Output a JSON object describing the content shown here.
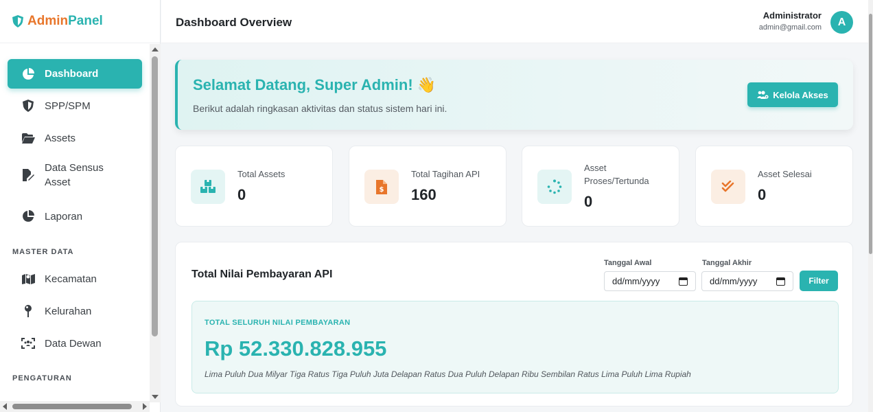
{
  "brand": {
    "part1": "Admin",
    "part2": "Panel"
  },
  "sidebar": {
    "items": [
      {
        "label": "Dashboard",
        "icon": "chart-pie-icon"
      },
      {
        "label": "SPP/SPM",
        "icon": "shield-icon"
      },
      {
        "label": "Assets",
        "icon": "folder-open-icon"
      },
      {
        "label": "Data Sensus Asset",
        "icon": "file-signature-icon"
      },
      {
        "label": "Laporan",
        "icon": "chart-pie-icon"
      }
    ],
    "section_master": "MASTER DATA",
    "master_items": [
      {
        "label": "Kecamatan",
        "icon": "map-icon"
      },
      {
        "label": "Kelurahan",
        "icon": "map-pin-icon"
      },
      {
        "label": "Data Dewan",
        "icon": "users-viewfinder-icon"
      }
    ],
    "section_settings": "PENGATURAN"
  },
  "header": {
    "title": "Dashboard Overview",
    "user_name": "Administrator",
    "user_email": "admin@gmail.com",
    "avatar_letter": "A"
  },
  "welcome": {
    "title": "Selamat Datang, Super Admin! 👋",
    "subtitle": "Berikut adalah ringkasan aktivitas dan status sistem hari ini.",
    "button": "Kelola Akses"
  },
  "stats": [
    {
      "label": "Total Assets",
      "value": "0",
      "icon": "boxes-icon"
    },
    {
      "label": "Total Tagihan API",
      "value": "160",
      "icon": "invoice-dollar-icon"
    },
    {
      "label": "Asset Proses/Tertunda",
      "value": "0",
      "icon": "spinner-icon"
    },
    {
      "label": "Asset Selesai",
      "value": "0",
      "icon": "check-double-icon"
    }
  ],
  "payment": {
    "title": "Total Nilai Pembayaran API",
    "start_label": "Tanggal Awal",
    "end_label": "Tanggal Akhir",
    "start_placeholder": "dd/mm/yyyy",
    "end_placeholder": "dd/mm/yyyy",
    "filter_button": "Filter",
    "total_caption": "TOTAL SELURUH NILAI PEMBAYARAN",
    "total_amount": "Rp 52.330.828.955",
    "total_words": "Lima Puluh Dua Milyar Tiga Ratus Tiga Puluh Juta Delapan Ratus Dua Puluh Delapan Ribu Sembilan Ratus Lima Puluh Lima Rupiah"
  },
  "colors": {
    "accent": "#2ab3b0",
    "brand_orange": "#e8762b"
  }
}
